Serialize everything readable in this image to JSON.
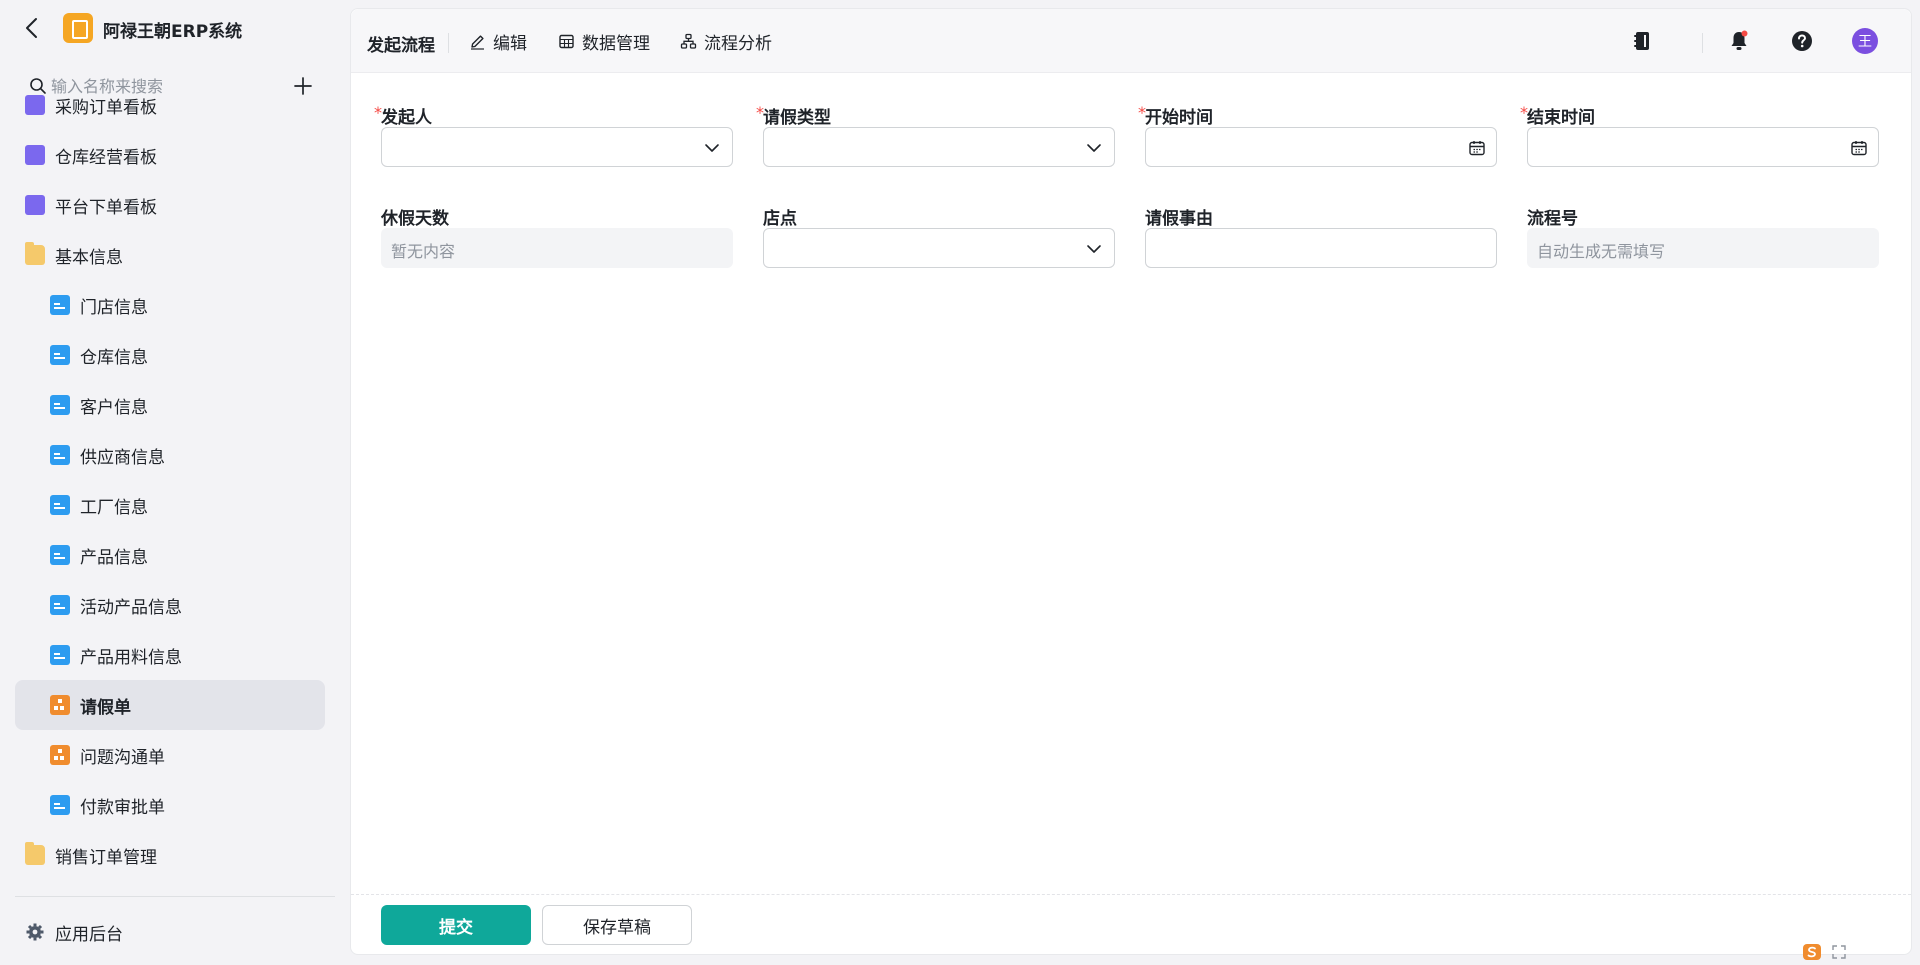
{
  "app": {
    "title": "阿禄王朝ERP系统"
  },
  "search": {
    "placeholder": "输入名称来搜索"
  },
  "sidebar": {
    "items": [
      {
        "label": "采购订单看板",
        "icon": "chart-icon",
        "level": 0
      },
      {
        "label": "仓库经营看板",
        "icon": "chart-icon",
        "level": 0
      },
      {
        "label": "平台下单看板",
        "icon": "chart-icon",
        "level": 0
      },
      {
        "label": "基本信息",
        "icon": "folder-open-icon",
        "level": 0
      },
      {
        "label": "门店信息",
        "icon": "form-icon",
        "level": 1
      },
      {
        "label": "仓库信息",
        "icon": "form-icon",
        "level": 1
      },
      {
        "label": "客户信息",
        "icon": "form-icon",
        "level": 1
      },
      {
        "label": "供应商信息",
        "icon": "form-icon",
        "level": 1
      },
      {
        "label": "工厂信息",
        "icon": "form-icon",
        "level": 1
      },
      {
        "label": "产品信息",
        "icon": "form-icon",
        "level": 1
      },
      {
        "label": "活动产品信息",
        "icon": "form-icon",
        "level": 1
      },
      {
        "label": "产品用料信息",
        "icon": "form-icon",
        "level": 1
      },
      {
        "label": "请假单",
        "icon": "flow-icon",
        "level": 1,
        "active": true
      },
      {
        "label": "问题沟通单",
        "icon": "flow-icon",
        "level": 1
      },
      {
        "label": "付款审批单",
        "icon": "form-icon",
        "level": 1
      },
      {
        "label": "销售订单管理",
        "icon": "folder-icon",
        "level": 0
      }
    ],
    "footer_label": "应用后台"
  },
  "toolbar": {
    "title": "发起流程",
    "edit": "编辑",
    "data_manage": "数据管理",
    "flow_analysis": "流程分析",
    "avatar_text": "王"
  },
  "form": {
    "row1": [
      {
        "label": "发起人",
        "required": true,
        "type": "select"
      },
      {
        "label": "请假类型",
        "required": true,
        "type": "select"
      },
      {
        "label": "开始时间",
        "required": true,
        "type": "date"
      },
      {
        "label": "结束时间",
        "required": true,
        "type": "date"
      }
    ],
    "row2": [
      {
        "label": "休假天数",
        "required": false,
        "type": "readonly",
        "value": "暂无内容"
      },
      {
        "label": "店点",
        "required": false,
        "type": "select"
      },
      {
        "label": "请假事由",
        "required": false,
        "type": "text"
      },
      {
        "label": "流程号",
        "required": false,
        "type": "readonly",
        "value": "自动生成无需填写"
      }
    ]
  },
  "actions": {
    "submit": "提交",
    "save_draft": "保存草稿"
  },
  "colors": {
    "primary": "#0fa89a",
    "required": "#f54a45",
    "avatar": "#7b4fe0"
  }
}
